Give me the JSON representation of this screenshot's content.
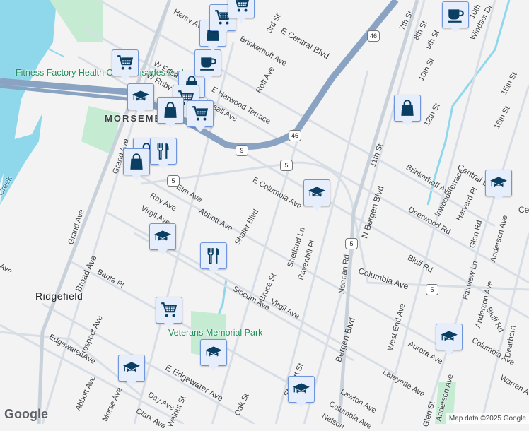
{
  "poi": {
    "fitness": "Fitness Factory Health Club Palisades Park",
    "park": "Veterans Memorial Park"
  },
  "places": {
    "morsemere": "MORSEMERE",
    "ridgefield": "Ridgefield",
    "creek": "Creek"
  },
  "streets": [
    "Henry Ave",
    "Brinkerhoff Ave",
    "3rd St",
    "Roff Ave",
    "E Central Blvd",
    "W Edsall",
    "W Ruby",
    "E Harwood Terrace",
    "Edsall Ave",
    "Grand Ave",
    "Broad Ave",
    "Grand Ave",
    "Elm Ave",
    "Ray Ave",
    "Virgil Ave",
    "Abbott Ave",
    "Shaler Blvd",
    "E Columbia Ave",
    "Shetland Ln",
    "Ravenhill Pl",
    "Banta Pl",
    "Prospect Ave",
    "Slocum Ave",
    "Bruce St",
    "Virgil Ave",
    "Edgewater Ave",
    "E Edgewater Ave",
    "Abbott Ave",
    "Morse Ave",
    "Day Ave",
    "Clark Ave",
    "Walnut St",
    "Oak St",
    "Stewart St",
    "Lawton Ave",
    "Columbia Ave",
    "Nelson",
    "Norman Rd",
    "Bergen Blvd",
    "N Bergen Blvd",
    "11th St",
    "7th St",
    "8th St",
    "9th St",
    "10th St",
    "12th St",
    "Windsor Dr",
    "15th St",
    "16th St",
    "Brinkerhoff Ave",
    "Central Blvd",
    "Deerwood Rd",
    "Inwood Terrace",
    "Harvard Pl",
    "Glen Rd",
    "Anderson Ave",
    "Fairview Ln",
    "Anderson Ave",
    "Bluff Rd",
    "Bluff Rd",
    "Columbia Ave",
    "West End Ave",
    "Aurora Ave",
    "Lafayette Ave",
    "Columbia Ave",
    "Warren A",
    "Anderson Ave",
    "Glen St",
    "Dearborn",
    "Ce",
    "10th",
    "Ave"
  ],
  "shields": [
    "46",
    "46",
    "9",
    "5",
    "5",
    "5",
    "5"
  ],
  "markers": [
    "shopping-cart",
    "graduation-cap",
    "shopping-bag",
    "shopping-cart",
    "shopping-cart",
    "coffee",
    "shopping-bag",
    "shopping-cart",
    "shopping-cart",
    "shopping-bag",
    "restaurant",
    "shopping-bag",
    "shopping-bag",
    "graduation-cap",
    "graduation-cap",
    "restaurant",
    "shopping-cart",
    "graduation-cap",
    "graduation-cap",
    "graduation-cap",
    "shopping-bag",
    "coffee",
    "graduation-cap",
    "graduation-cap"
  ],
  "footer": {
    "logo": "Google",
    "attribution": "Map data ©2025 Google"
  },
  "colors": {
    "highway": "#8aa3c2",
    "water": "#8fd8ec",
    "park": "#c5ecd3",
    "marker_icon": "#0b3e63",
    "road": "#d5dce4"
  }
}
